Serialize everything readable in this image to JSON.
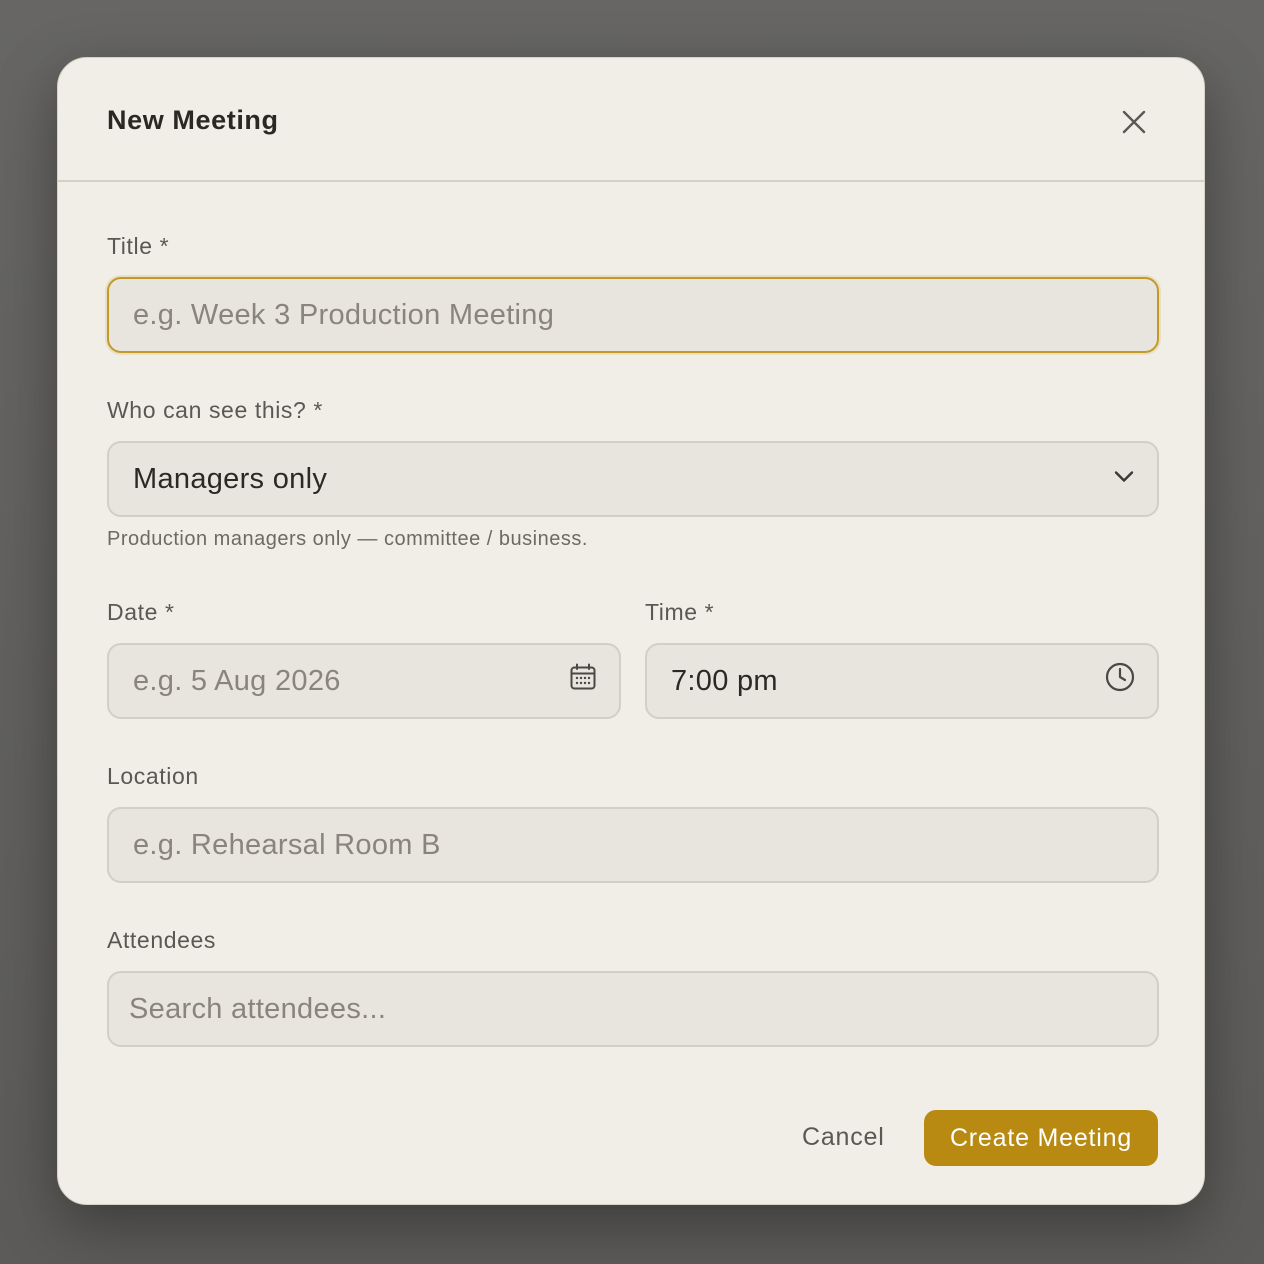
{
  "dialog": {
    "title": "New Meeting",
    "close_icon": "close-icon"
  },
  "fields": {
    "title": {
      "label": "Title *",
      "placeholder": "e.g. Week 3 Production Meeting"
    },
    "visibility": {
      "label": "Who can see this? *",
      "selected": "Managers only",
      "hint": "Production managers only — committee / business.",
      "icon": "chevron-down-icon"
    },
    "date": {
      "label": "Date *",
      "placeholder": "e.g. 5 Aug 2026",
      "icon": "calendar-icon"
    },
    "time": {
      "label": "Time *",
      "value": "7:00 pm",
      "icon": "clock-icon"
    },
    "location": {
      "label": "Location",
      "placeholder": "e.g. Rehearsal Room B"
    },
    "attendees": {
      "label": "Attendees",
      "placeholder": "Search attendees..."
    }
  },
  "actions": {
    "cancel_label": "Cancel",
    "create_label": "Create Meeting"
  },
  "colors": {
    "accent": "#b88a12",
    "focus_border": "#c39a2a",
    "dialog_bg": "#f1eee7",
    "field_bg": "#e8e5de"
  }
}
